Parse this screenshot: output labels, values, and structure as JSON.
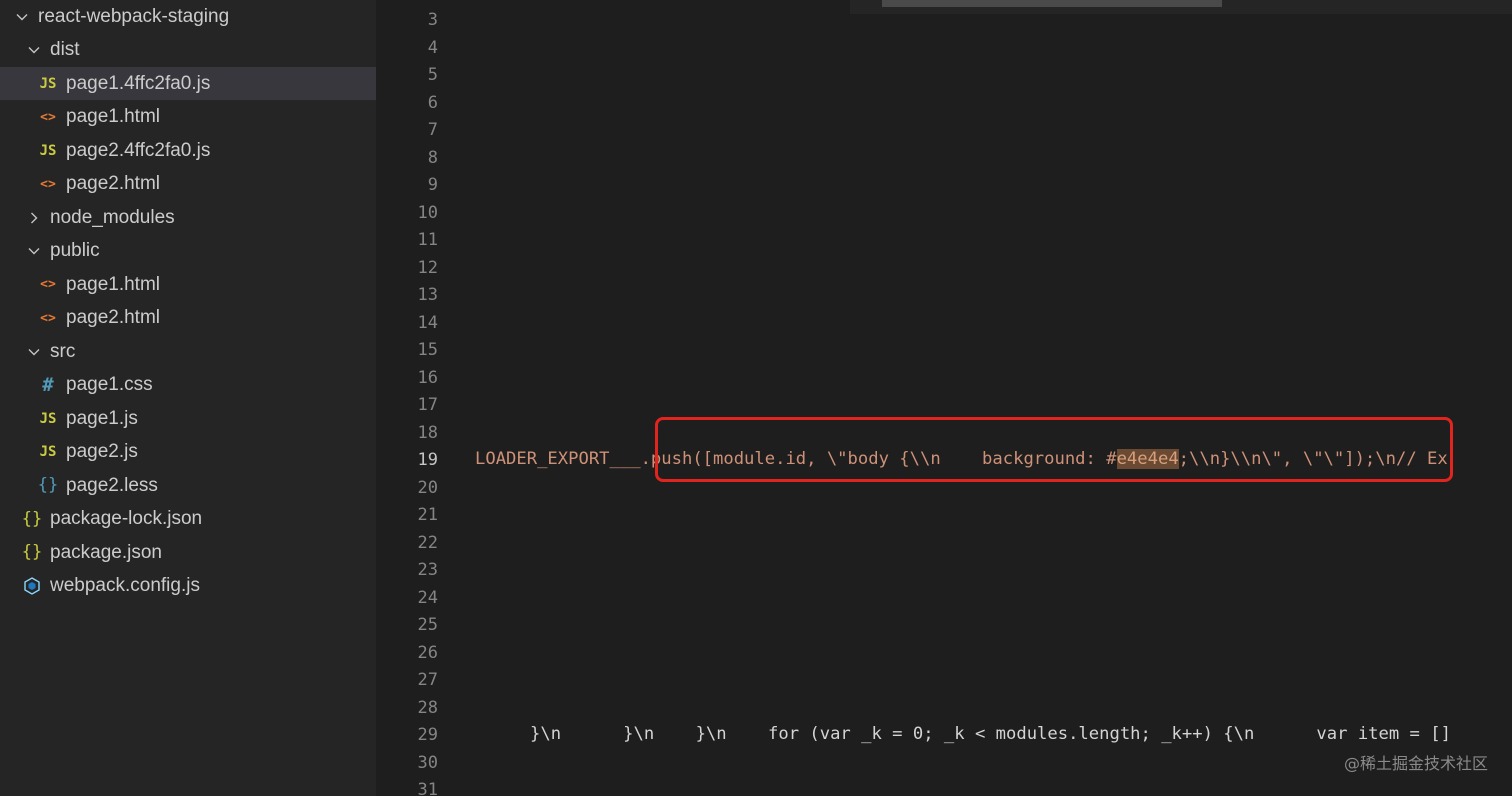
{
  "explorer": {
    "root_label": "react-webpack-staging",
    "items": [
      {
        "label": "dist",
        "kind": "folder",
        "expanded": true,
        "icon": "chevron-down-icon"
      },
      {
        "label": "page1.4ffc2fa0.js",
        "kind": "js",
        "icon": "JS",
        "selected": true
      },
      {
        "label": "page1.html",
        "kind": "html",
        "icon": "<>"
      },
      {
        "label": "page2.4ffc2fa0.js",
        "kind": "js",
        "icon": "JS"
      },
      {
        "label": "page2.html",
        "kind": "html",
        "icon": "<>"
      },
      {
        "label": "node_modules",
        "kind": "folder",
        "expanded": false,
        "icon": "chevron-right-icon"
      },
      {
        "label": "public",
        "kind": "folder",
        "expanded": true,
        "icon": "chevron-down-icon"
      },
      {
        "label": "page1.html",
        "kind": "html",
        "icon": "<>"
      },
      {
        "label": "page2.html",
        "kind": "html",
        "icon": "<>"
      },
      {
        "label": "src",
        "kind": "folder",
        "expanded": true,
        "icon": "chevron-down-icon"
      },
      {
        "label": "page1.css",
        "kind": "css",
        "icon": "#"
      },
      {
        "label": "page1.js",
        "kind": "js",
        "icon": "JS"
      },
      {
        "label": "page2.js",
        "kind": "js",
        "icon": "JS"
      },
      {
        "label": "page2.less",
        "kind": "less",
        "icon": "{}"
      },
      {
        "label": "package-lock.json",
        "kind": "json",
        "icon": "{}"
      },
      {
        "label": "package.json",
        "kind": "json",
        "icon": "{}"
      },
      {
        "label": "webpack.config.js",
        "kind": "webpack",
        "icon": "webpack-cube-icon"
      }
    ]
  },
  "editor": {
    "line_numbers": [
      "3",
      "4",
      "5",
      "6",
      "7",
      "8",
      "9",
      "10",
      "11",
      "12",
      "13",
      "14",
      "15",
      "16",
      "17",
      "18",
      "19",
      "20",
      "21",
      "22",
      "23",
      "24",
      "25",
      "26",
      "27",
      "28",
      "29",
      "30",
      "31"
    ],
    "current_line": "19",
    "line19": {
      "prefix": "LOADER_EXPORT___",
      "code_a": ".push([module.id, \\\"body {\\\\n    background: #",
      "highlight": "e4e4e4",
      "code_b": ";\\\\n}\\\\n\\\", \\\"\\\"]);\\n// Ex"
    },
    "line29": "}\\n      }\\n    }\\n    for (var _k = 0; _k < modules.length; _k++) {\\n      var item = []"
  },
  "watermark": "@稀土掘金技术社区",
  "colors": {
    "sidebar_bg": "#252526",
    "editor_bg": "#1e1e1e",
    "selected_row": "#37373d",
    "string": "#ce9178",
    "annotation_box": "#e0241e"
  }
}
